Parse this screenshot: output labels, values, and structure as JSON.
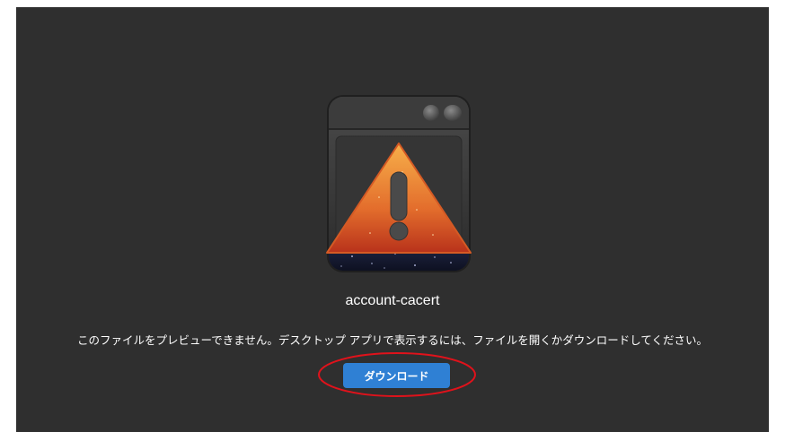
{
  "file": {
    "name": "account-cacert",
    "message": "このファイルをプレビューできません。デスクトップ アプリで表示するには、ファイルを開くかダウンロードしてください。"
  },
  "actions": {
    "download_label": "ダウンロード"
  },
  "icons": {
    "preview": "warning-window-icon"
  },
  "colors": {
    "background": "#2f2f2f",
    "button": "#2f80d4",
    "highlight": "#e0121b",
    "warning_top": "#f29a3a",
    "warning_bottom": "#b8321b"
  }
}
